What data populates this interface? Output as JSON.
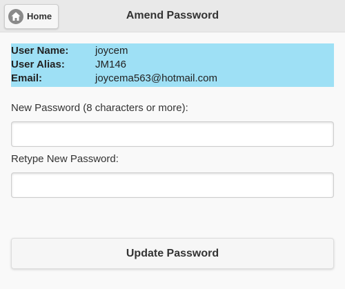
{
  "header": {
    "home_label": "Home",
    "home_icon": "home-icon",
    "title": "Amend Password"
  },
  "account": {
    "rows": [
      {
        "label": "User Name:",
        "value": "joycem"
      },
      {
        "label": "User Alias:",
        "value": "JM146"
      },
      {
        "label": "Email:",
        "value": "joycema563@hotmail.com"
      }
    ]
  },
  "form": {
    "new_password_label": "New Password (8 characters or more):",
    "new_password_value": "",
    "retype_password_label": "Retype New Password:",
    "retype_password_value": "",
    "submit_label": "Update Password"
  },
  "colors": {
    "info_background": "#9ee0f5",
    "header_background": "#e9e9e9",
    "page_background": "#f9f9f9"
  }
}
